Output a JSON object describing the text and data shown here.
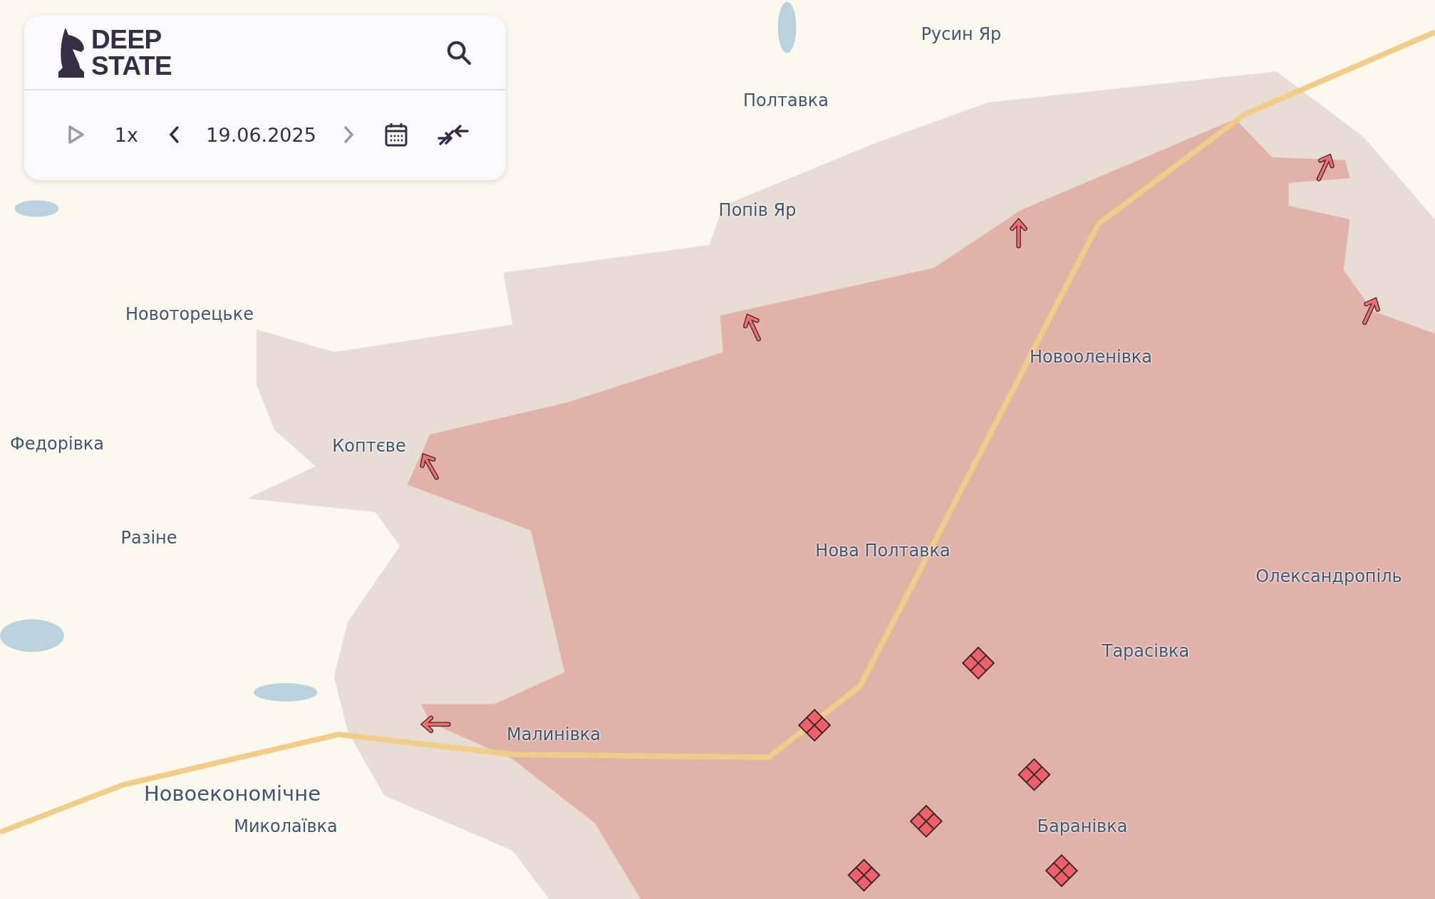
{
  "panel": {
    "logo": {
      "line_1": "DEEP",
      "line_2": "STATE"
    },
    "controls": {
      "play_disabled": true,
      "speed": "1x",
      "date": "19.06.2025",
      "prev_disabled": false,
      "next_disabled": true
    }
  },
  "map": {
    "places": [
      {
        "name": "Русин Яр",
        "kind": "village"
      },
      {
        "name": "Полтавка",
        "kind": "village"
      },
      {
        "name": "Попів Яр",
        "kind": "village"
      },
      {
        "name": "Новоторецьке",
        "kind": "village"
      },
      {
        "name": "Новооленівка",
        "kind": "village"
      },
      {
        "name": "Федорівка",
        "kind": "village"
      },
      {
        "name": "Коптєве",
        "kind": "village"
      },
      {
        "name": "Разіне",
        "kind": "village"
      },
      {
        "name": "Нова Полтавка",
        "kind": "village"
      },
      {
        "name": "Олександропіль",
        "kind": "village"
      },
      {
        "name": "Тарасівка",
        "kind": "village"
      },
      {
        "name": "Малинівка",
        "kind": "village"
      },
      {
        "name": "Новоекономічне",
        "kind": "town"
      },
      {
        "name": "Миколаївка",
        "kind": "village"
      },
      {
        "name": "Баранівка",
        "kind": "village"
      }
    ]
  }
}
